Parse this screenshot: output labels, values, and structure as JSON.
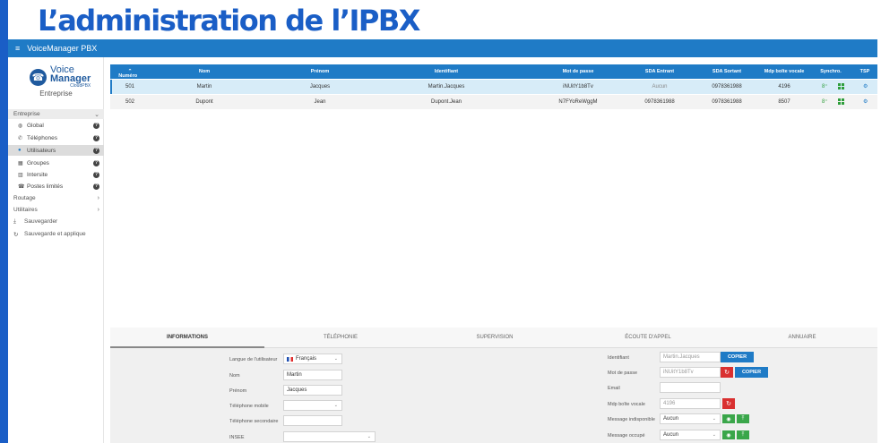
{
  "slide_title": "L’administration de l’IPBX",
  "app": {
    "menu_icon": "hamburger-icon",
    "title": "VoiceManager PBX"
  },
  "logo": {
    "line1": "Voice",
    "line2": "Manager",
    "line3": "CloudPBX",
    "icon": "phone-globe-icon"
  },
  "company": "Entreprise",
  "sidebar": {
    "section_entreprise": "Entreprise",
    "items": [
      {
        "label": "Global",
        "icon": "globe-icon",
        "help": "?"
      },
      {
        "label": "Téléphones",
        "icon": "phone-icon",
        "help": "?"
      },
      {
        "label": "Utilisateurs",
        "icon": "user-icon",
        "help": "?"
      },
      {
        "label": "Groupes",
        "icon": "group-icon",
        "help": "?"
      },
      {
        "label": "Intersite",
        "icon": "building-icon",
        "help": "?"
      },
      {
        "label": "Postes limités",
        "icon": "fax-icon",
        "help": "?"
      }
    ],
    "section_routage": "Routage",
    "section_utilitaires": "Utilitaires",
    "save": "Sauvegarder",
    "save_apply": "Sauvegarde et applique"
  },
  "table": {
    "headers": [
      "Numéro",
      "Nom",
      "Prénom",
      "Identifiant",
      "Mot de passe",
      "SDA Entrant",
      "SDA Sortant",
      "Mdp boîte vocale",
      "Synchro.",
      "TSP"
    ],
    "rows": [
      {
        "numero": "501",
        "nom": "Martin",
        "prenom": "Jacques",
        "identifiant": "Martin.Jacques",
        "mdp": "iNUitY1b8Tv",
        "sda_in": "Aucun",
        "sda_out": "0978361988",
        "mdp_vm": "4196"
      },
      {
        "numero": "502",
        "nom": "Dupont",
        "prenom": "Jean",
        "identifiant": "Dupont.Jean",
        "mdp": "N7FYoReWggM",
        "sda_in": "0978361988",
        "sda_out": "0978361988",
        "mdp_vm": "8507"
      }
    ]
  },
  "tabs": [
    "INFORMATIONS",
    "TÉLÉPHONIE",
    "SUPERVISION",
    "ÉCOUTE D'APPEL",
    "ANNUAIRE"
  ],
  "form_left": {
    "langue_label": "Langue de l'utilisateur",
    "langue_value": "Français",
    "nom_label": "Nom",
    "nom_value": "Martin",
    "prenom_label": "Prénom",
    "prenom_value": "Jacques",
    "mobile_label": "Téléphone mobile",
    "mobile_value": "",
    "secondaire_label": "Téléphone secondaire",
    "secondaire_value": "",
    "insee_label": "INSEE",
    "insee_value": ""
  },
  "form_right": {
    "identifiant_label": "Identifiant",
    "identifiant_value": "Martin.Jacques",
    "copy1": "COPIER",
    "mdp_label": "Mot de passe",
    "mdp_value": "iNUitY1b8Tv",
    "copy2": "COPIER",
    "email_label": "Email",
    "email_value": "",
    "vm_label": "Mdp boîte vocale",
    "vm_value": "4196",
    "indispo_label": "Message indisponible",
    "indispo_value": "Aucun",
    "occupe_label": "Message occupé",
    "occupe_value": "Aucun"
  }
}
